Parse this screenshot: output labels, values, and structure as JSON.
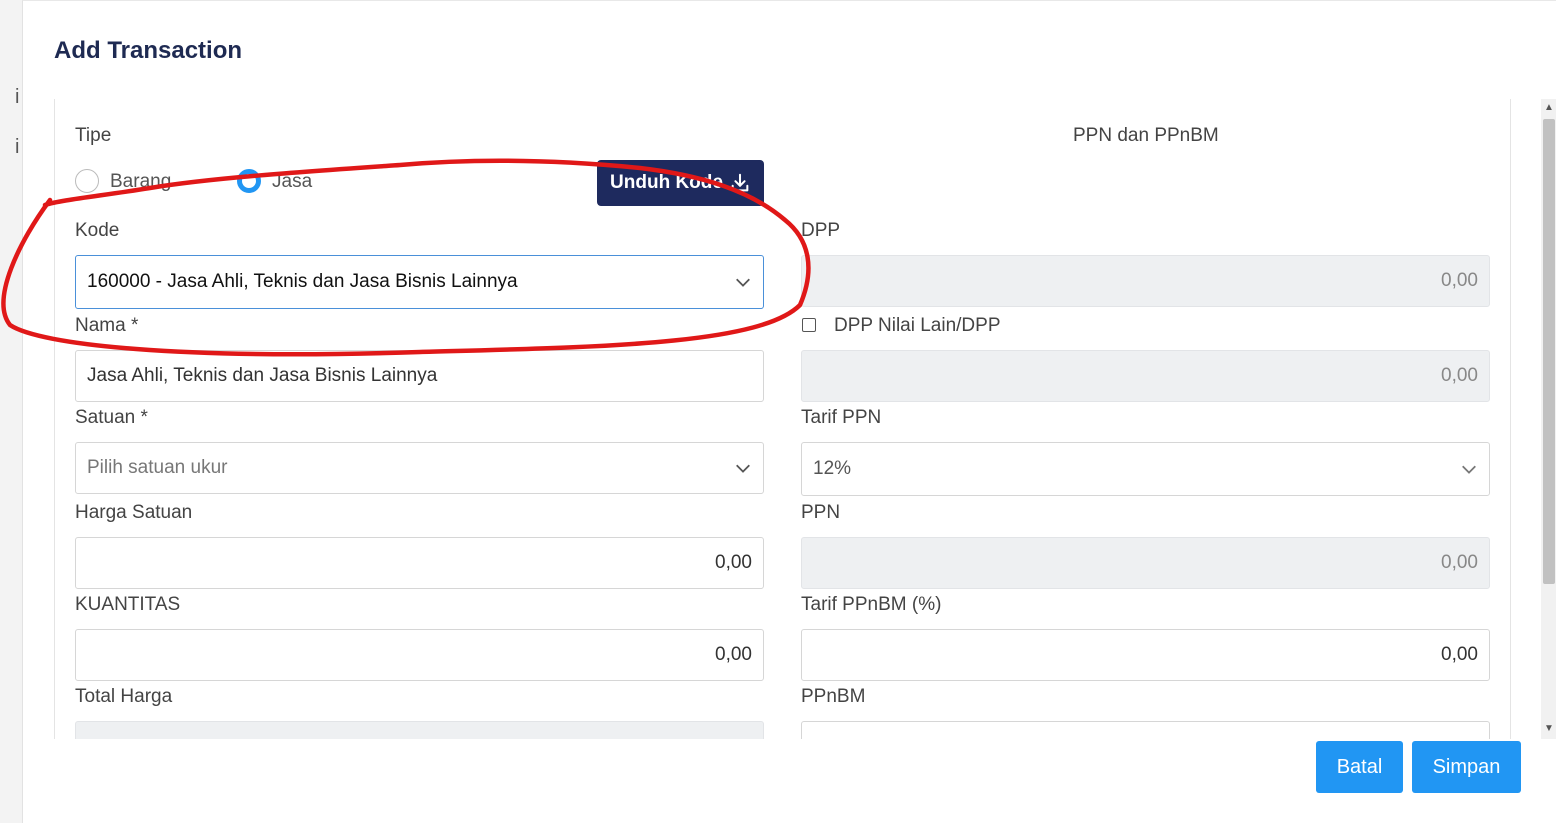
{
  "background": {
    "fragment_1": "i",
    "fragment_2": "i"
  },
  "modal": {
    "title": "Add Transaction"
  },
  "form": {
    "tipe_label": "Tipe",
    "radio_barang": "Barang",
    "radio_jasa": "Jasa",
    "selected_tipe": "Jasa",
    "unduh_button": "Unduh Kode",
    "kode_label": "Kode",
    "kode_value": "160000 - Jasa Ahli, Teknis dan Jasa Bisnis Lainnya",
    "nama_label": "Nama *",
    "nama_value": "Jasa Ahli, Teknis dan Jasa Bisnis Lainnya",
    "satuan_label": "Satuan *",
    "satuan_placeholder": "Pilih satuan ukur",
    "harga_label": "Harga Satuan",
    "harga_value": "0,00",
    "kuantitas_label": "KUANTITAS",
    "kuantitas_value": "0,00",
    "total_label": "Total Harga"
  },
  "tax": {
    "section_title": "PPN dan PPnBM",
    "dpp_label": "DPP",
    "dpp_value": "0,00",
    "dpp_lain_label": "DPP Nilai Lain/DPP",
    "dpp_lain_value": "0,00",
    "tarif_ppn_label": "Tarif PPN",
    "tarif_ppn_value": "12%",
    "ppn_label": "PPN",
    "ppn_value": "0,00",
    "tarif_ppnbm_label": "Tarif PPnBM (%)",
    "tarif_ppnbm_value": "0,00",
    "ppnbm_label": "PPnBM"
  },
  "footer": {
    "batal": "Batal",
    "simpan": "Simpan"
  },
  "colors": {
    "primary": "#2196f3",
    "dark_button": "#1e2a5e",
    "title": "#1e2a52",
    "annotation": "#e01818"
  }
}
